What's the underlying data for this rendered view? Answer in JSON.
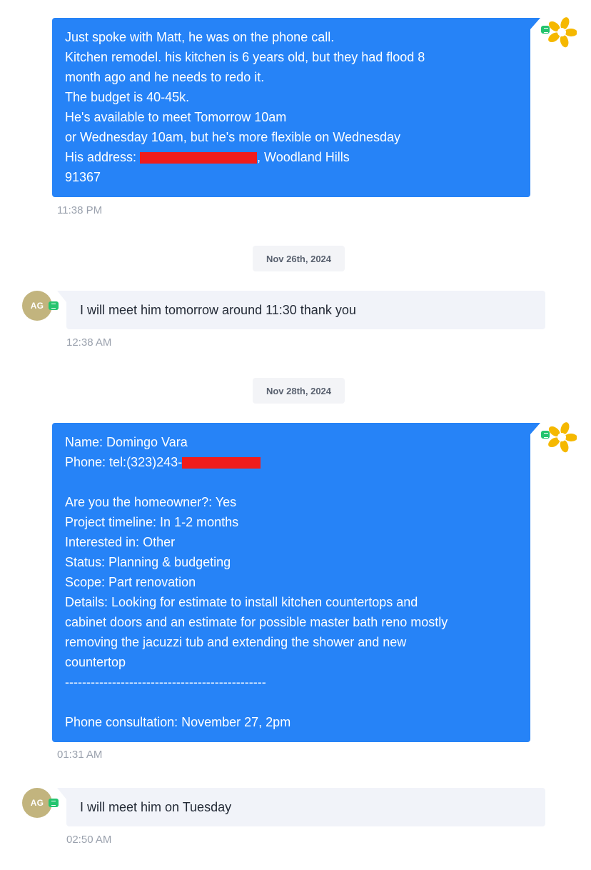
{
  "messages": [
    {
      "direction": "outgoing",
      "lines": [
        "Just spoke with Matt, he was on the phone call.",
        "Kitchen remodel. his kitchen is 6 years old, but they had flood 8",
        "month ago and he needs to redo it.",
        "The budget is 40-45k.",
        "He's available to meet Tomorrow 10am",
        "or Wednesday 10am, but he's more flexible on Wednesday",
        "His address: ",
        "91367"
      ],
      "address_suffix": ", Woodland Hills",
      "time": "11:38 PM"
    },
    {
      "direction": "incoming",
      "avatar_initials": "AG",
      "text": "I will meet him tomorrow around 11:30 thank you",
      "time": "12:38 AM"
    },
    {
      "direction": "outgoing",
      "lines": [
        "Name: Domingo Vara",
        "Phone: tel:(323)243-",
        "",
        "Are you the homeowner?: Yes",
        "Project timeline: In 1-2 months",
        "Interested in: Other",
        "Status: Planning & budgeting",
        "Scope: Part renovation",
        "Details: Looking for estimate to install kitchen countertops and",
        "cabinet doors and an estimate for possible master bath reno mostly",
        "removing the jacuzzi tub and extending the shower and new",
        "countertop",
        "-----------------------------------------------",
        "",
        "Phone consultation: November 27, 2pm"
      ],
      "time": "01:31 AM"
    },
    {
      "direction": "incoming",
      "avatar_initials": "AG",
      "text": "I will meet him on Tuesday",
      "time": "02:50 AM"
    }
  ],
  "date_separators": [
    "Nov 26th, 2024",
    "Nov 28th, 2024"
  ],
  "icons": {
    "sender_avatar": "pinwheel-logo-icon",
    "channel_badge": "chat-bubble-icon"
  },
  "colors": {
    "outgoing_bubble": "#2683f7",
    "incoming_bubble": "#f1f3f9",
    "avatar_bg": "#c2b47e",
    "channel_badge": "#24c46e",
    "redaction": "#f01c1c"
  }
}
